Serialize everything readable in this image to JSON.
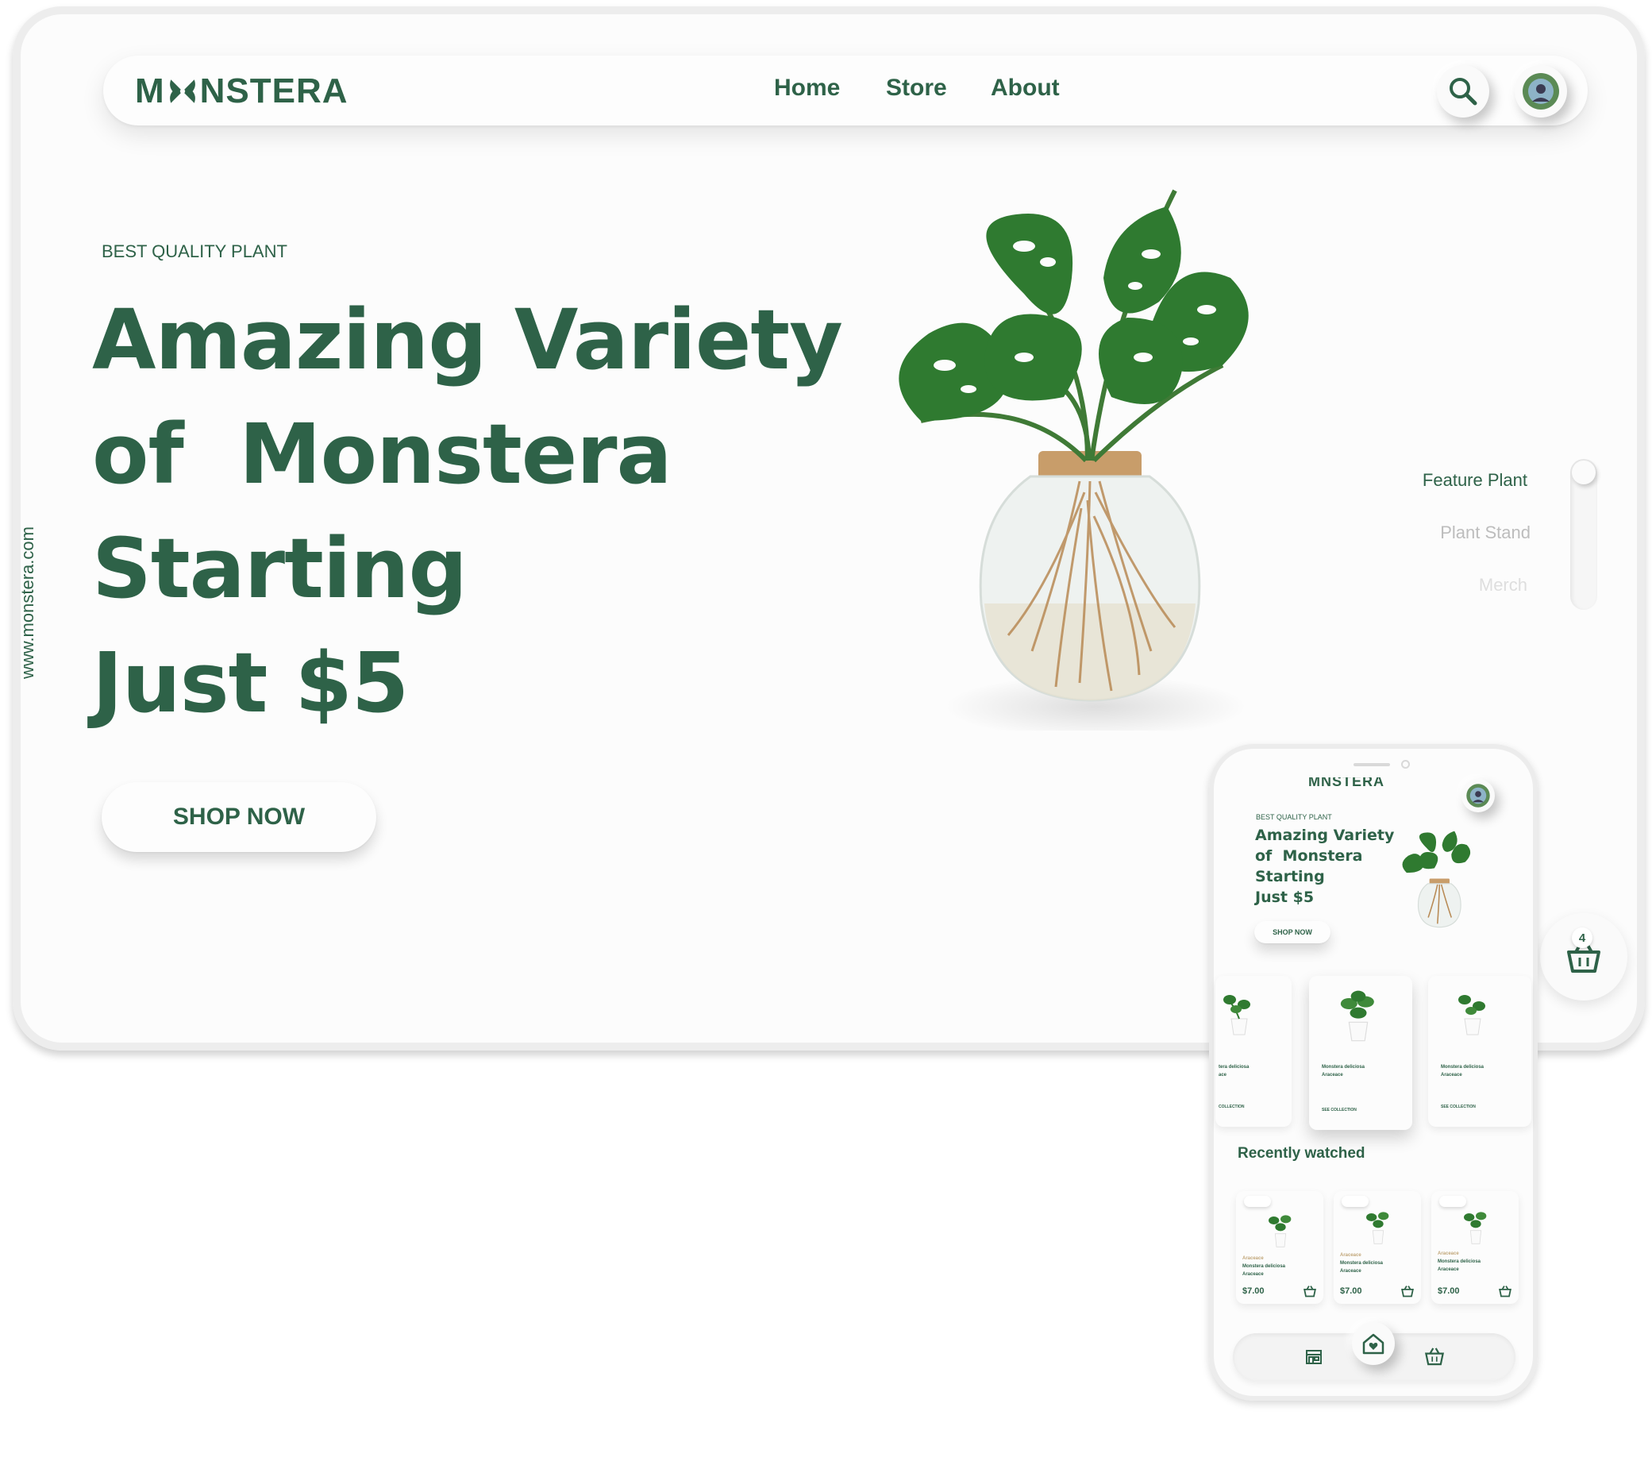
{
  "brand": {
    "logo_text_left": "M",
    "logo_text_right": "NSTERA",
    "website": "www.monstera.com"
  },
  "nav": {
    "links": [
      "Home",
      "Store",
      "About"
    ]
  },
  "hero": {
    "eyebrow": "BEST QUALITY PLANT",
    "lines": [
      "Amazing Variety",
      "of  Monstera",
      "Starting",
      "Just $5"
    ],
    "cta": "SHOP NOW"
  },
  "side_menu": {
    "items": [
      "Feature Plant",
      "Plant Stand",
      "Merch"
    ]
  },
  "cart": {
    "count": "4"
  },
  "mobile": {
    "logo": "MNSTERA",
    "eyebrow": "BEST QUALITY PLANT",
    "lines": [
      "Amazing Variety",
      "of  Monstera",
      "Starting",
      "Just $5"
    ],
    "cta": "SHOP NOW",
    "carousel": [
      {
        "title": "tera deliciosa",
        "subtitle": "ace",
        "link": "COLLECTION"
      },
      {
        "title": "Monstera deliciosa",
        "subtitle": "Araceace",
        "link": "SEE COLLECTION"
      },
      {
        "title": "Monstera deliciosa",
        "subtitle": "Araceace",
        "link": "SEE COLLECTION"
      }
    ],
    "recent_title": "Recently watched",
    "recent": [
      {
        "category": "Araceace",
        "name": "Monstera deliciosa",
        "sub": "Araceace",
        "price": "$7.00"
      },
      {
        "category": "Araceace",
        "name": "Monstera deliciosa",
        "sub": "Araceace",
        "price": "$7.00"
      },
      {
        "category": "Araceace",
        "name": "Monstera deliciosa",
        "sub": "Araceace",
        "price": "$7.00"
      }
    ]
  },
  "colors": {
    "brand_green": "#2e6248",
    "background": "#fcfcfc"
  }
}
